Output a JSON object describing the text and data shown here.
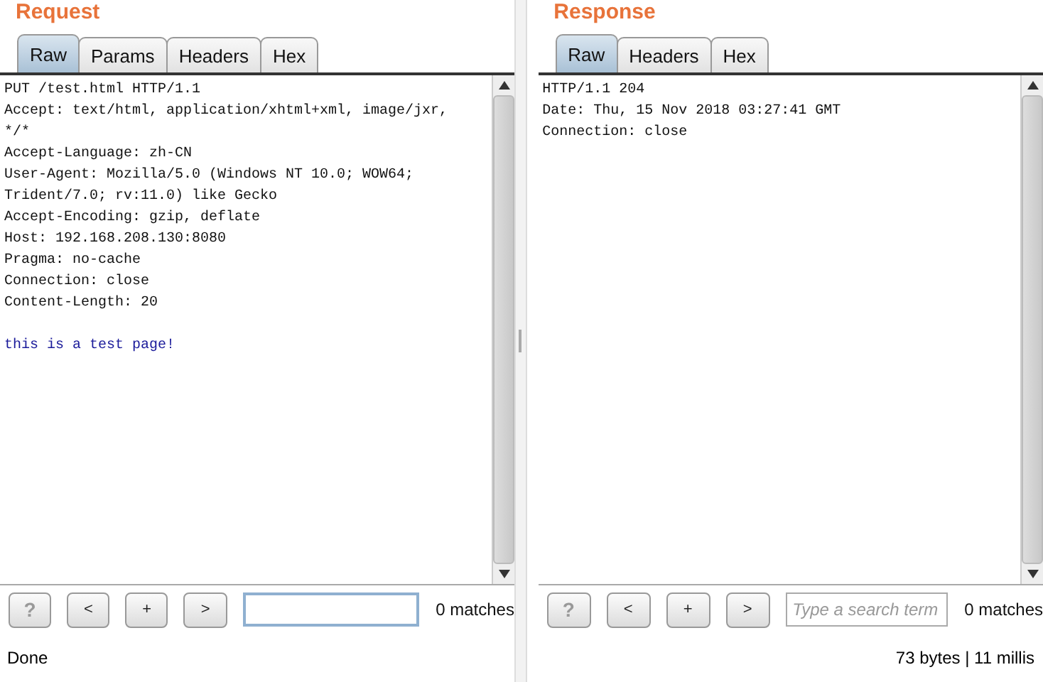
{
  "panes": [
    {
      "title": "Request",
      "tabs": [
        {
          "label": "Raw",
          "selected": true
        },
        {
          "label": "Params",
          "selected": false
        },
        {
          "label": "Headers",
          "selected": false
        },
        {
          "label": "Hex",
          "selected": false
        }
      ],
      "lines": [
        {
          "kind": "header",
          "text": "PUT /test.html HTTP/1.1"
        },
        {
          "kind": "header",
          "text": "Accept: text/html, application/xhtml+xml, image/jxr,"
        },
        {
          "kind": "header",
          "text": "*/*"
        },
        {
          "kind": "header",
          "text": "Accept-Language: zh-CN"
        },
        {
          "kind": "header",
          "text": "User-Agent: Mozilla/5.0 (Windows NT 10.0; WOW64;"
        },
        {
          "kind": "header",
          "text": "Trident/7.0; rv:11.0) like Gecko"
        },
        {
          "kind": "header",
          "text": "Accept-Encoding: gzip, deflate"
        },
        {
          "kind": "header",
          "text": "Host: 192.168.208.130:8080"
        },
        {
          "kind": "header",
          "text": "Pragma: no-cache"
        },
        {
          "kind": "header",
          "text": "Connection: close"
        },
        {
          "kind": "header",
          "text": "Content-Length: 20"
        },
        {
          "kind": "gap"
        },
        {
          "kind": "body",
          "text": "this is a test page!"
        }
      ],
      "buttons": [
        "?",
        "<",
        "+",
        ">"
      ],
      "search": {
        "focused": true
      },
      "matches": "0 matches",
      "status": "Done"
    },
    {
      "title": "Response",
      "tabs": [
        {
          "label": "Raw",
          "selected": true
        },
        {
          "label": "Headers",
          "selected": false
        },
        {
          "label": "Hex",
          "selected": false
        }
      ],
      "lines": [
        {
          "kind": "header",
          "text": "HTTP/1.1 204"
        },
        {
          "kind": "header",
          "text": "Date: Thu, 15 Nov 2018 03:27:41 GMT"
        },
        {
          "kind": "header",
          "text": "Connection: close"
        }
      ],
      "buttons": [
        "?",
        "<",
        "+",
        ">"
      ],
      "search": {
        "placeholder": "Type a search term",
        "focused": false
      },
      "matches": "0 matches",
      "status": "73 bytes | 11 millis"
    }
  ]
}
